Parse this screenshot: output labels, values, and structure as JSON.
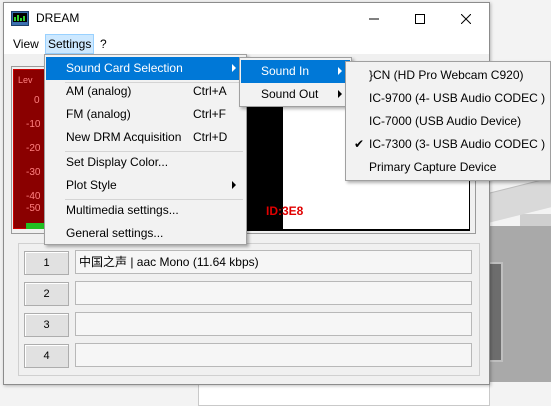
{
  "window": {
    "title": "DREAM"
  },
  "menubar": {
    "items": [
      "View",
      "Settings",
      "?"
    ]
  },
  "display": {
    "level_label": "Lev",
    "scale": [
      "0",
      "-10",
      "-20",
      "-30",
      "-40",
      "-50"
    ],
    "id_text": "ID:3E8"
  },
  "services": [
    {
      "number": "1",
      "text": "中国之声  |   aac Mono (11.64 kbps)"
    },
    {
      "number": "2",
      "text": ""
    },
    {
      "number": "3",
      "text": ""
    },
    {
      "number": "4",
      "text": ""
    }
  ],
  "settings_menu": [
    {
      "label": "Sound Card Selection",
      "shortcut": "",
      "submenu": true
    },
    {
      "label": "AM (analog)",
      "shortcut": "Ctrl+A"
    },
    {
      "label": "FM (analog)",
      "shortcut": "Ctrl+F"
    },
    {
      "label": "New DRM Acquisition",
      "shortcut": "Ctrl+D"
    },
    {
      "label": "Set Display Color...",
      "shortcut": ""
    },
    {
      "label": "Plot Style",
      "shortcut": "",
      "submenu": true
    },
    {
      "label": "Multimedia settings...",
      "shortcut": ""
    },
    {
      "label": "General settings...",
      "shortcut": ""
    }
  ],
  "sound_card_menu": [
    {
      "label": "Sound In",
      "submenu": true
    },
    {
      "label": "Sound Out",
      "submenu": true
    }
  ],
  "sound_in_menu": [
    {
      "label": "}CN (HD Pro Webcam C920)",
      "checked": false
    },
    {
      "label": "IC-9700 (4- USB Audio CODEC )",
      "checked": false
    },
    {
      "label": "IC-7000 (USB Audio Device)",
      "checked": false
    },
    {
      "label": "IC-7300 (3- USB Audio CODEC )",
      "checked": true
    },
    {
      "label": "Primary Capture Device",
      "checked": false
    }
  ],
  "colors": {
    "highlight": "#0078d7",
    "meter": "#8a0000",
    "id_text": "#e00000"
  }
}
